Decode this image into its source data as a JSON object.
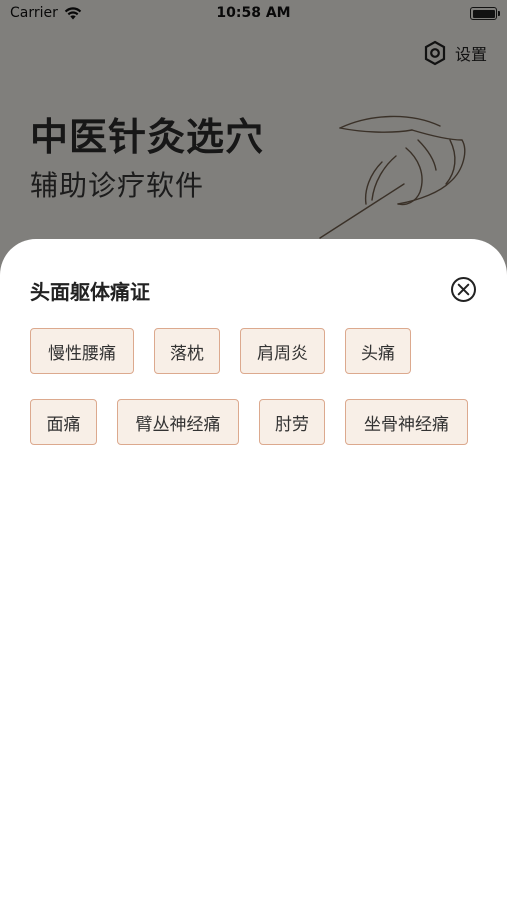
{
  "status_bar": {
    "carrier": "Carrier",
    "time": "10:58 AM"
  },
  "background_screen": {
    "settings_label": "设置",
    "title": "中医针灸选穴",
    "subtitle": "辅助诊疗软件"
  },
  "sheet": {
    "title": "头面躯体痛证",
    "tags": [
      "慢性腰痛",
      "落枕",
      "肩周炎",
      "头痛",
      "面痛",
      "臂丛神经痛",
      "肘劳",
      "坐骨神经痛"
    ]
  },
  "colors": {
    "tag_fill": "#f8efe7",
    "tag_border": "#dca98e",
    "overlay": "rgba(0,0,0,0.45)"
  }
}
